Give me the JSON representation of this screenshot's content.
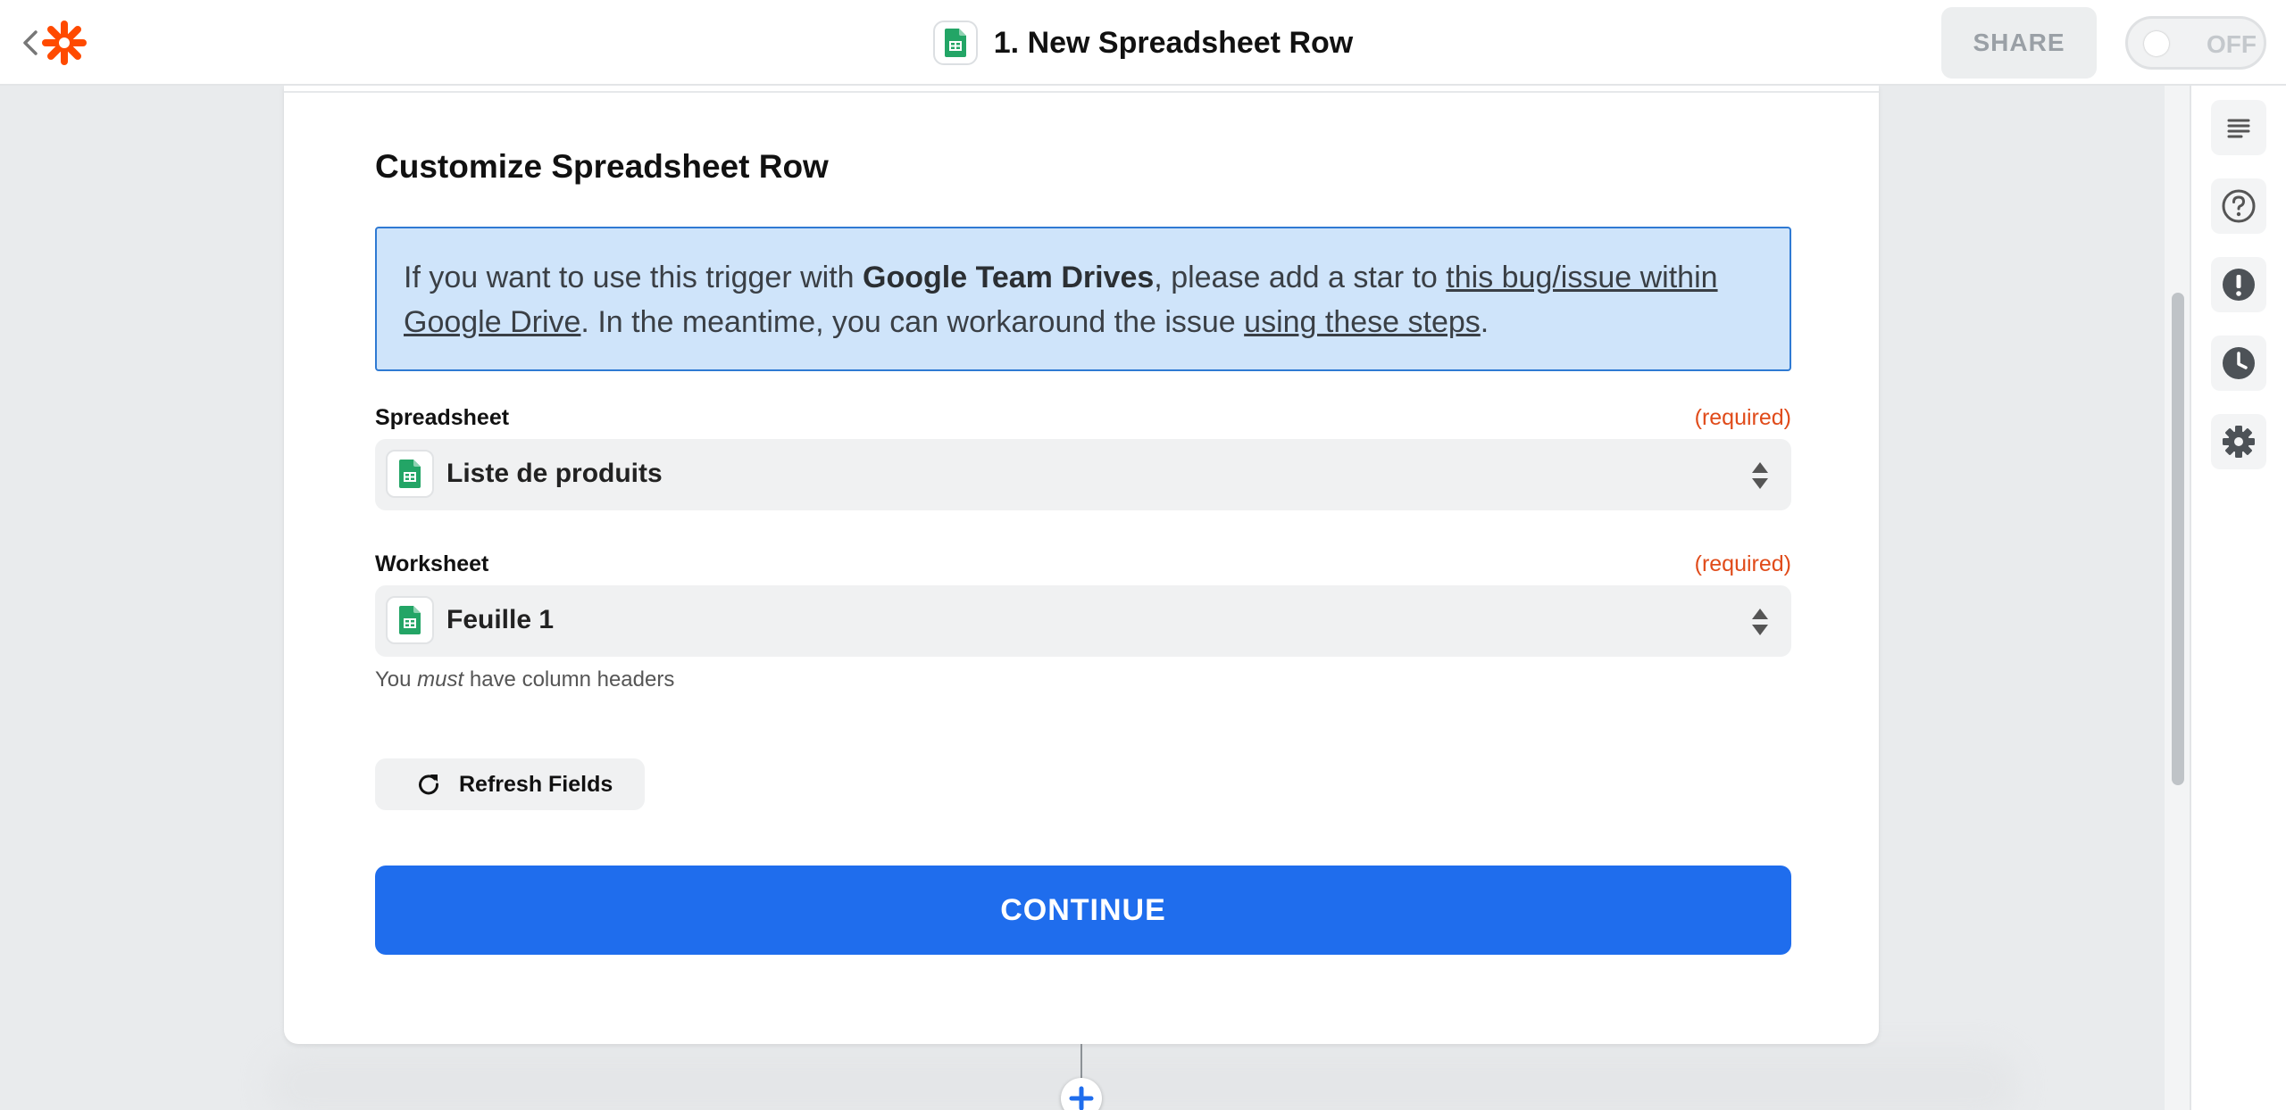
{
  "header": {
    "zap_title": "1. New Spreadsheet Row",
    "share_label": "SHARE",
    "toggle_label": "OFF"
  },
  "icons": {
    "back": "chevron-left-icon",
    "logo": "zapier-logo",
    "app": "google-sheets-icon",
    "sidebar": [
      "details-icon",
      "help-icon",
      "alert-icon",
      "history-icon",
      "settings-icon"
    ]
  },
  "colors": {
    "brand": "#ff4a00",
    "primary": "#1f6ded",
    "sheets_green": "#23a566",
    "alert_bg": "#cfe4fa",
    "alert_border": "#2f7ad3",
    "required": "#e04b1a"
  },
  "section": {
    "title": "Customize Spreadsheet Row"
  },
  "alert": {
    "t1": "If you want to use this trigger with ",
    "bold": "Google Team Drives",
    "t2": ", please add a star to ",
    "link1": "this bug/issue within Google Drive",
    "t3": ". In the meantime, you can workaround the issue ",
    "link2": "using these steps",
    "t4": "."
  },
  "fields": {
    "spreadsheet": {
      "label": "Spreadsheet",
      "required": "(required)",
      "value": "Liste de produits"
    },
    "worksheet": {
      "label": "Worksheet",
      "required": "(required)",
      "value": "Feuille 1",
      "help_prefix": "You ",
      "help_em": "must",
      "help_suffix": " have column headers"
    }
  },
  "buttons": {
    "refresh": "Refresh Fields",
    "continue": "CONTINUE"
  }
}
